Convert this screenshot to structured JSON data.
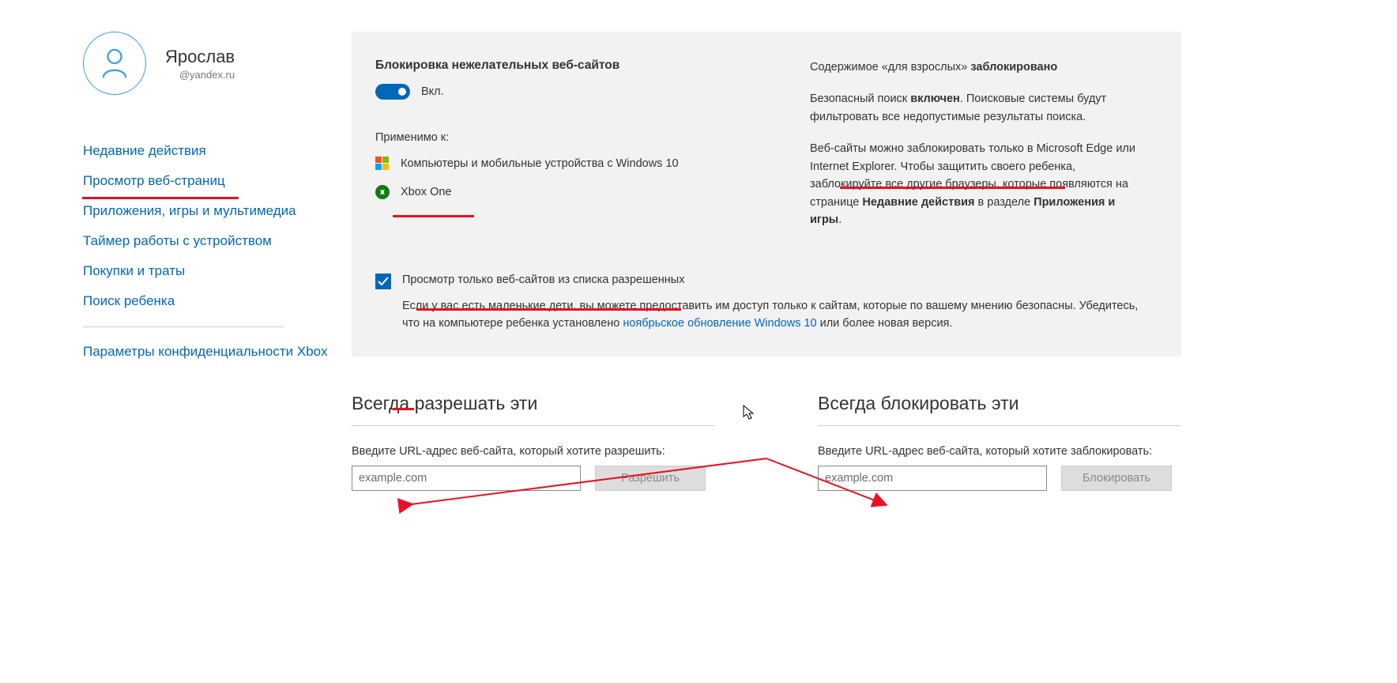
{
  "profile": {
    "name": "Ярослав",
    "email": "@yandex.ru"
  },
  "nav": {
    "items": [
      "Недавние действия",
      "Просмотр веб-страниц",
      "Приложения, игры и мультимедиа",
      "Таймер работы с устройством",
      "Покупки и траты",
      "Поиск ребенка"
    ],
    "extra": "Параметры конфиденциальности Xbox"
  },
  "blocking": {
    "title": "Блокировка нежелательных веб-сайтов",
    "toggle_state": "Вкл."
  },
  "applies": {
    "title": "Применимо к:",
    "win10": "Компьютеры и мобильные устройства с Windows 10",
    "xbox": "Xbox One"
  },
  "right": {
    "line1_pre": "Содержимое «для взрослых» ",
    "line1_bold": "заблокировано",
    "line2_pre": "Безопасный поиск ",
    "line2_bold": "включен",
    "line2_post": ". Поисковые системы будут фильтровать все недопустимые результаты поиска.",
    "para2_pre": "Веб-сайты можно заблокировать только в Microsoft Edge или Internet Explorer. Чтобы защитить своего ребенка, заблокируйте все другие браузеры, которые появляются на странице ",
    "para2_bold1": "Недавние действия",
    "para2_mid": " в разделе ",
    "para2_bold2": "Приложения и игры",
    "para2_end": "."
  },
  "allowlist": {
    "checkbox_label": "Просмотр только веб-сайтов из списка разрешенных",
    "help_pre": "Если у вас есть маленькие дети, вы можете предоставить им доступ только к сайтам, которые по вашему мнению безопасны. Убедитесь, что на компьютере ребенка установлено ",
    "help_link": "ноябрьское обновление Windows 10",
    "help_post": " или более новая версия."
  },
  "allow": {
    "title": "Всегда разрешать эти",
    "label": "Введите URL-адрес веб-сайта, который хотите разрешить:",
    "placeholder": "example.com",
    "button": "Разрешить"
  },
  "block": {
    "title": "Всегда блокировать эти",
    "label": "Введите URL-адрес веб-сайта, который хотите заблокировать:",
    "placeholder": "example.com",
    "button": "Блокировать"
  }
}
